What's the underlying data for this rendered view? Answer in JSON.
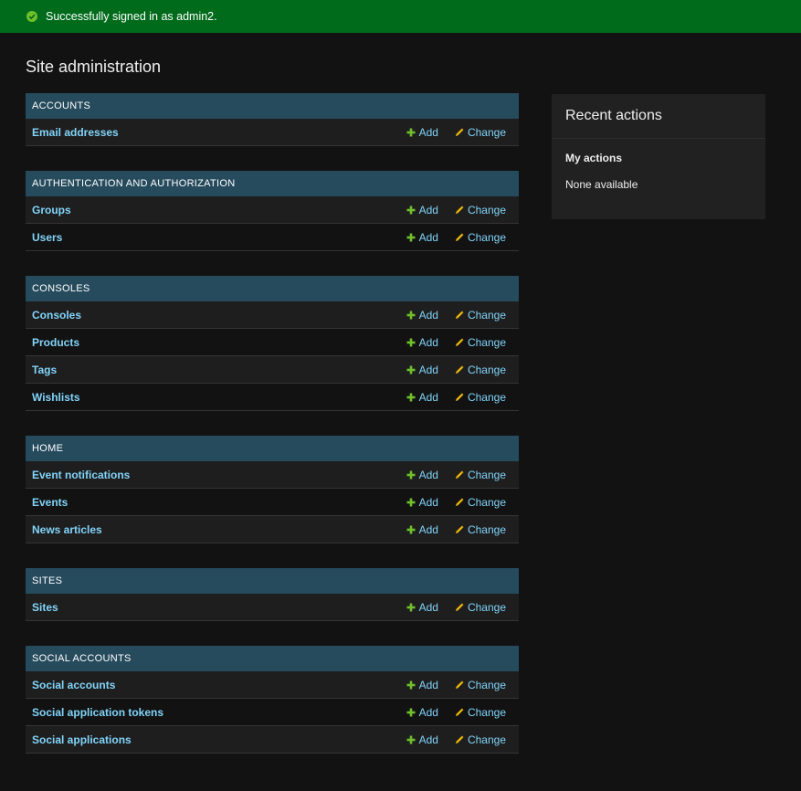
{
  "message": {
    "text": "Successfully signed in as admin2.",
    "icon": "check-circle-icon",
    "color": "#006b1b"
  },
  "page_title": "Site administration",
  "actions": {
    "add_label": "Add",
    "change_label": "Change"
  },
  "modules": [
    {
      "title": "ACCOUNTS",
      "models": [
        "Email addresses"
      ]
    },
    {
      "title": "AUTHENTICATION AND AUTHORIZATION",
      "models": [
        "Groups",
        "Users"
      ]
    },
    {
      "title": "CONSOLES",
      "models": [
        "Consoles",
        "Products",
        "Tags",
        "Wishlists"
      ]
    },
    {
      "title": "HOME",
      "models": [
        "Event notifications",
        "Events",
        "News articles"
      ]
    },
    {
      "title": "SITES",
      "models": [
        "Sites"
      ]
    },
    {
      "title": "SOCIAL ACCOUNTS",
      "models": [
        "Social accounts",
        "Social application tokens",
        "Social applications"
      ]
    }
  ],
  "recent_actions": {
    "title": "Recent actions",
    "subtitle": "My actions",
    "empty_text": "None available"
  },
  "colors": {
    "header_bg": "#264b5d",
    "link": "#81d4fa",
    "add_icon": "#70bf2b",
    "change_icon": "#efb80b",
    "background": "#121212"
  }
}
